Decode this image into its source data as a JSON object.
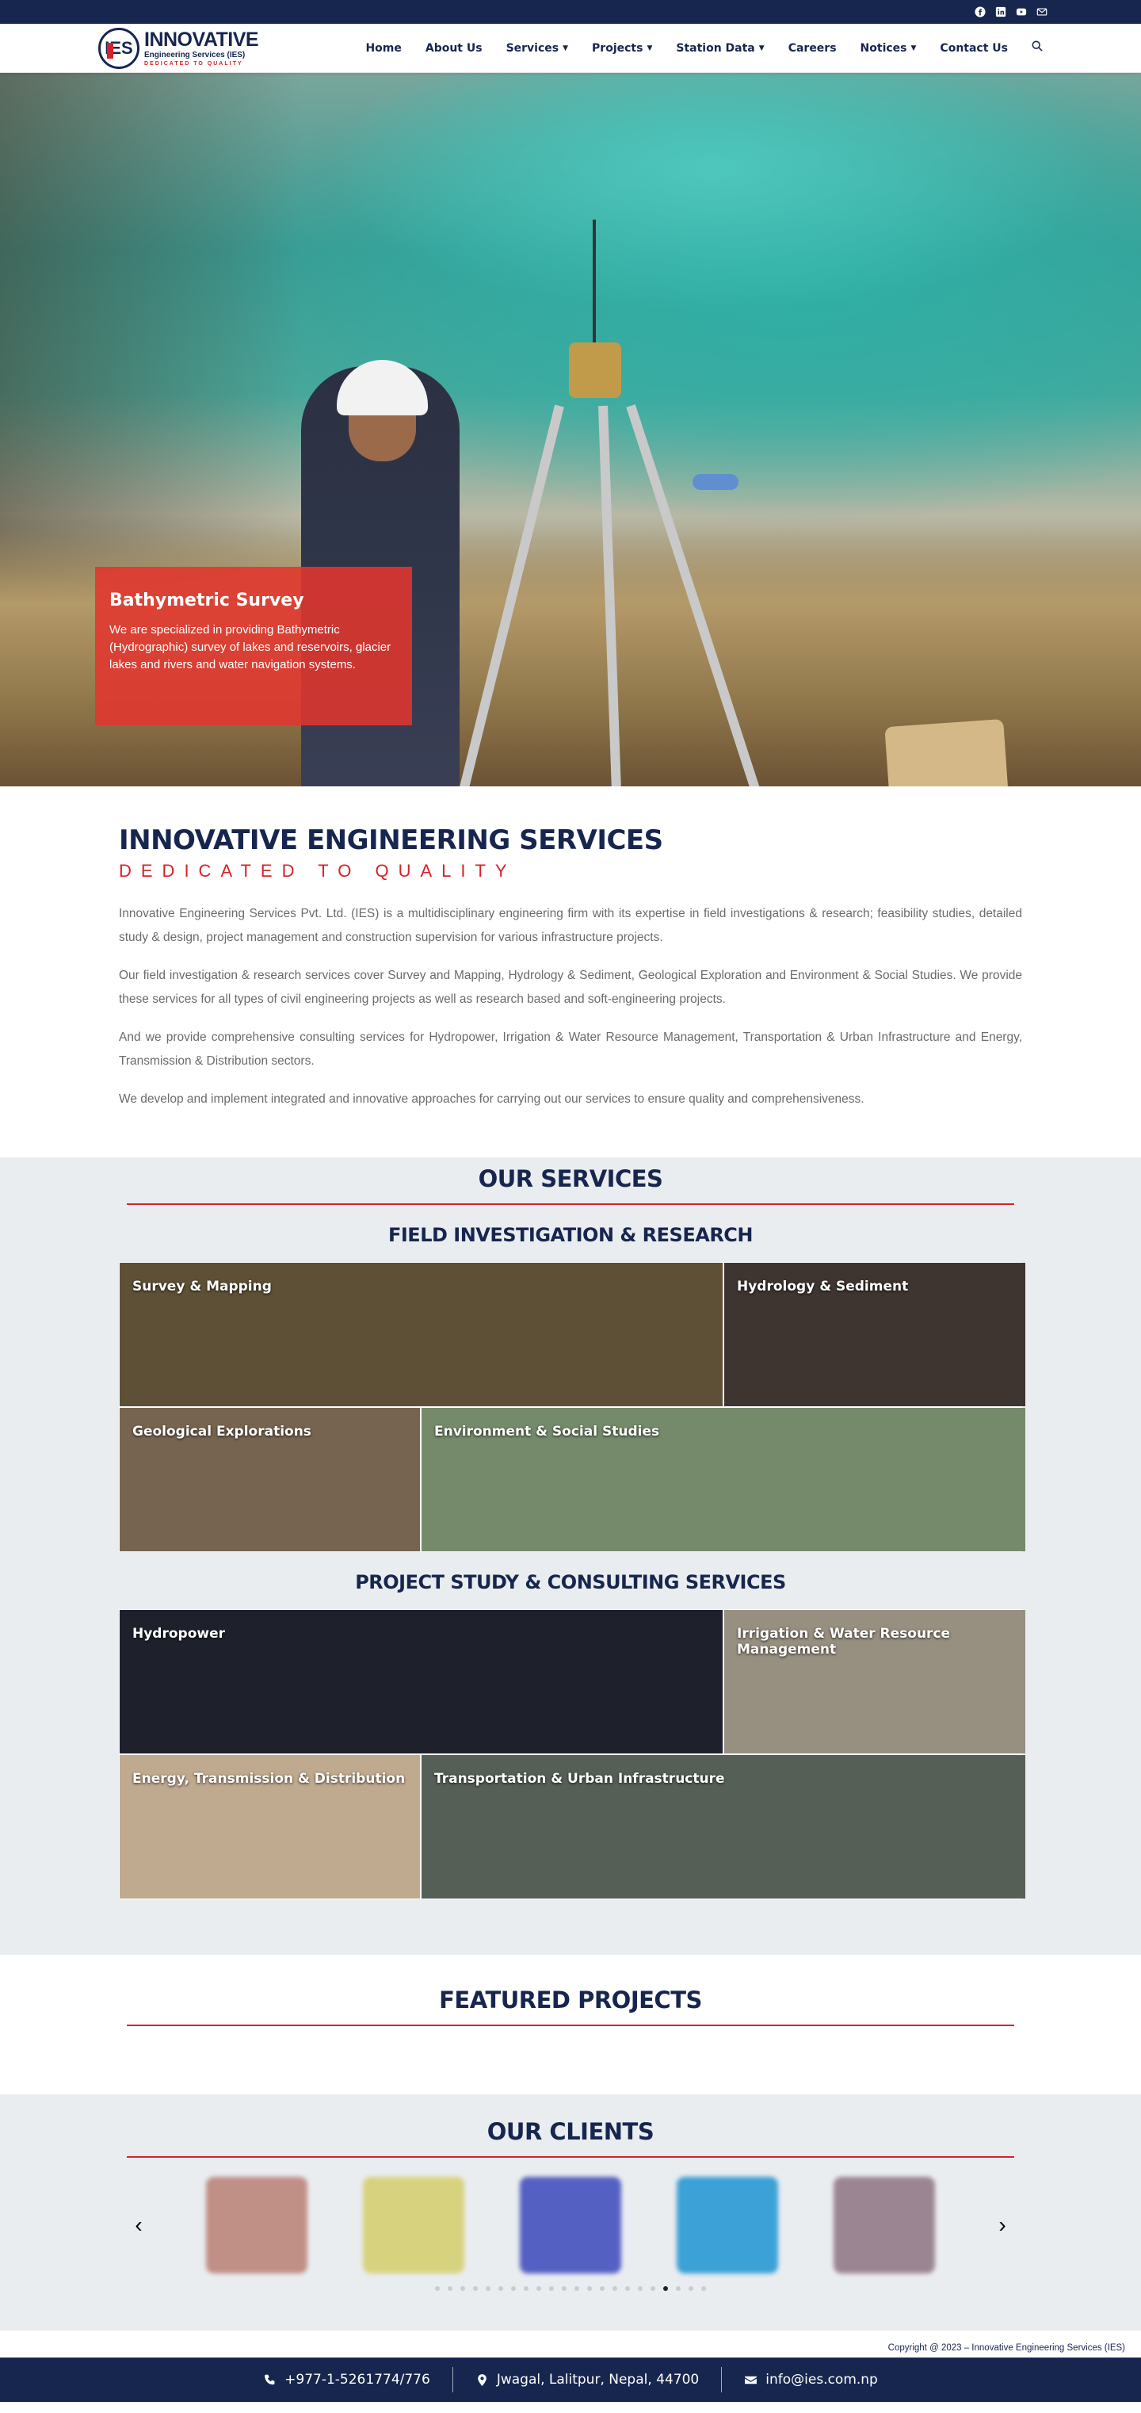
{
  "topbar": {
    "icons": [
      "facebook-icon",
      "linkedin-icon",
      "youtube-icon",
      "mail-icon"
    ]
  },
  "logo": {
    "line1": "INNOVATIVE",
    "line2": "Engineering Services (IES)",
    "line3": "DEDICATED TO QUALITY",
    "mark": "IES"
  },
  "nav": {
    "items": [
      {
        "label": "Home",
        "dropdown": false
      },
      {
        "label": "About Us",
        "dropdown": false
      },
      {
        "label": "Services",
        "dropdown": true
      },
      {
        "label": "Projects",
        "dropdown": true
      },
      {
        "label": "Station Data",
        "dropdown": true
      },
      {
        "label": "Careers",
        "dropdown": false
      },
      {
        "label": "Notices",
        "dropdown": true
      },
      {
        "label": "Contact Us",
        "dropdown": false
      }
    ]
  },
  "hero": {
    "title": "Bathymetric Survey",
    "text": "We are specialized in providing Bathymetric (Hydrographic) survey of lakes and reservoirs, glacier lakes and rivers and water navigation systems."
  },
  "about": {
    "title": "INNOVATIVE ENGINEERING SERVICES",
    "tagline": "DEDICATED TO QUALITY",
    "paragraphs": [
      "Innovative Engineering Services Pvt. Ltd. (IES) is a multidisciplinary engineering firm with its expertise in field investigations & research; feasibility studies, detailed study & design, project management and construction supervision for various infrastructure projects.",
      "Our field investigation & research services cover Survey and Mapping, Hydrology & Sediment, Geological Exploration and Environment & Social Studies. We provide these services for all types of civil engineering projects as well as research based and soft-engineering projects.",
      "And we provide comprehensive consulting services for Hydropower, Irrigation & Water Resource Management, Transportation & Urban Infrastructure and Energy, Transmission & Distribution sectors.",
      "We develop and implement integrated and innovative approaches for carrying out our services to ensure quality and comprehensiveness."
    ]
  },
  "services": {
    "title": "OUR SERVICES",
    "groups": [
      {
        "title": "FIELD INVESTIGATION & RESEARCH",
        "tiles": [
          {
            "label": "Survey & Mapping",
            "color": "#5d5036"
          },
          {
            "label": "Hydrology & Sediment",
            "color": "#3e3530"
          },
          {
            "label": "Geological Explorations",
            "color": "#776450"
          },
          {
            "label": "Environment & Social Studies",
            "color": "#758a6b"
          }
        ]
      },
      {
        "title": "PROJECT STUDY & CONSULTING SERVICES",
        "tiles": [
          {
            "label": "Hydropower",
            "color": "#1e212c"
          },
          {
            "label": "Irrigation & Water Resource Management",
            "color": "#978f80"
          },
          {
            "label": "Energy, Transmission & Distribution",
            "color": "#bfa98f"
          },
          {
            "label": "Transportation & Urban Infrastructure",
            "color": "#555f56"
          }
        ]
      }
    ]
  },
  "featured": {
    "title": "FEATURED PROJECTS"
  },
  "clients": {
    "title": "OUR CLIENTS",
    "logos": [
      "#c08f85",
      "#d7d27e",
      "#5461c2",
      "#3ba1d6",
      "#9b8592"
    ],
    "dot_count": 22,
    "active_dot": 18
  },
  "footer": {
    "copyright": "Copyright @ 2023 – Innovative Engineering Services (IES)",
    "phone": "+977-1-5261774/776",
    "address": "Jwagal, Lalitpur, Nepal, 44700",
    "email": "info@ies.com.np"
  }
}
